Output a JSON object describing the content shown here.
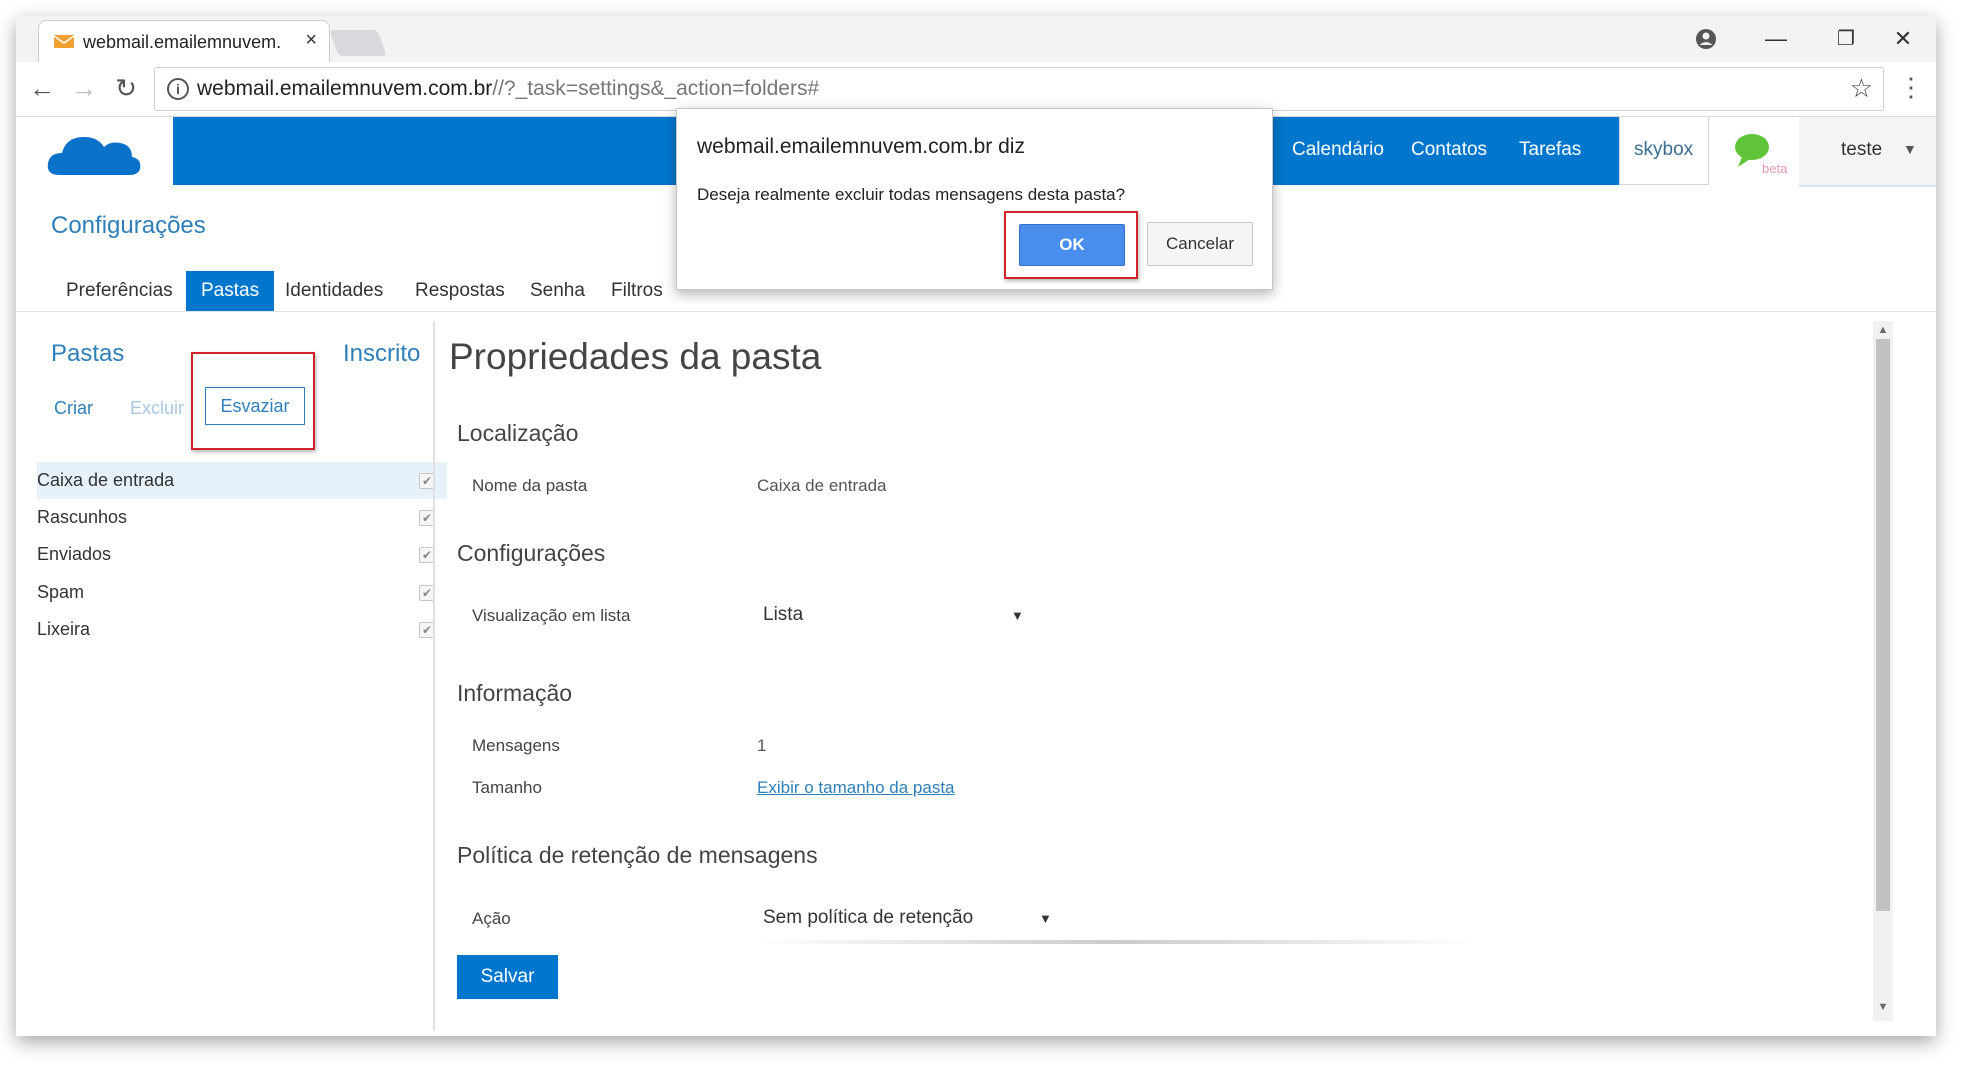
{
  "browser": {
    "tab_title": "webmail.emailemnuvem.",
    "tab_close": "×",
    "url_main": "webmail.emailemnuvem.com.br",
    "url_rest": "//?_task=settings&_action=folders#",
    "win_account": "●",
    "win_minimize": "—",
    "win_restore": "❐",
    "win_close": "✕",
    "back": "←",
    "forward": "→",
    "reload": "↻",
    "star": "☆",
    "menu": "⋮",
    "info": "i"
  },
  "header": {
    "nav": [
      "Calendário",
      "Contatos",
      "Tarefas"
    ],
    "skybox": "skybox",
    "beta": "beta",
    "user": "teste",
    "user_caret": "▼",
    "brand_color": "#0076cc"
  },
  "settings": {
    "title": "Configurações",
    "tabs": [
      "Preferências",
      "Pastas",
      "Identidades",
      "Respostas",
      "Senha",
      "Filtros"
    ],
    "active_tab": "Pastas"
  },
  "left": {
    "title": "Pastas",
    "subscribed": "Inscrito",
    "actions": {
      "create": "Criar",
      "delete": "Excluir",
      "empty": "Esvaziar"
    },
    "folders": [
      {
        "name": "Caixa de entrada",
        "subscribed": true
      },
      {
        "name": "Rascunhos",
        "subscribed": true
      },
      {
        "name": "Enviados",
        "subscribed": true
      },
      {
        "name": "Spam",
        "subscribed": true
      },
      {
        "name": "Lixeira",
        "subscribed": true
      }
    ],
    "check_mark": "✔"
  },
  "main": {
    "title": "Propriedades da pasta",
    "location": {
      "section": "Localização",
      "label": "Nome da pasta",
      "value": "Caixa de entrada"
    },
    "config": {
      "section": "Configurações",
      "label": "Visualização em lista",
      "value": "Lista"
    },
    "info": {
      "section": "Informação",
      "messages_label": "Mensagens",
      "messages_value": "1",
      "size_label": "Tamanho",
      "size_link": "Exibir o tamanho da pasta"
    },
    "retention": {
      "section": "Política de retenção de mensagens",
      "label": "Ação",
      "value": "Sem política de retenção"
    },
    "caret": "▼",
    "save": "Salvar"
  },
  "dialog": {
    "title": "webmail.emailemnuvem.com.br diz",
    "message": "Deseja realmente excluir todas mensagens desta pasta?",
    "ok": "OK",
    "cancel": "Cancelar"
  },
  "scroll": {
    "up": "▲",
    "down": "▼"
  }
}
